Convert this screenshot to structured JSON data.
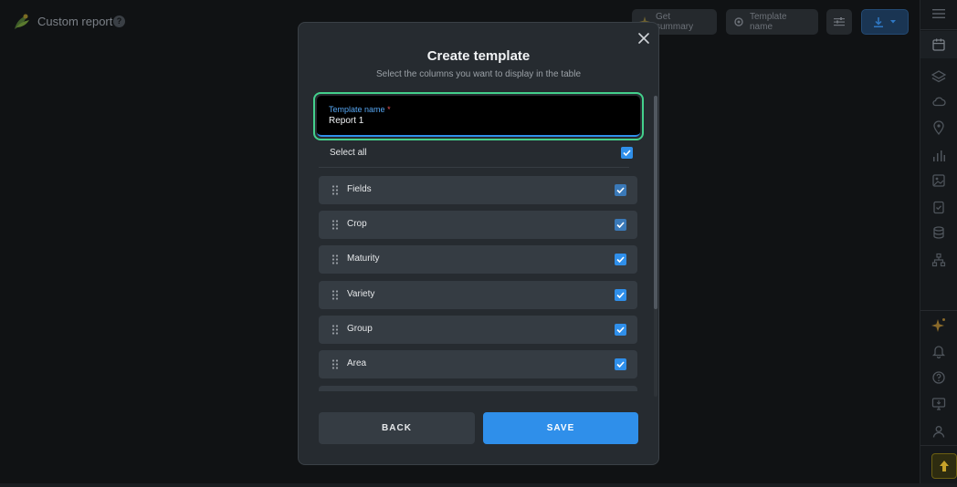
{
  "app": {
    "title": "Custom report",
    "help_glyph": "?"
  },
  "toolbar": {
    "summary_label": "Get summary",
    "template_label": "Template name"
  },
  "modal": {
    "title": "Create template",
    "subtitle": "Select the columns you want to display in the table",
    "name_field": {
      "label": "Template name",
      "required_mark": "*",
      "value": "Report 1"
    },
    "select_all": {
      "label": "Select all",
      "checked": true
    },
    "columns": [
      {
        "label": "Fields",
        "checked": true
      },
      {
        "label": "Crop",
        "checked": true
      },
      {
        "label": "Maturity",
        "checked": true
      },
      {
        "label": "Variety",
        "checked": true
      },
      {
        "label": "Group",
        "checked": true
      },
      {
        "label": "Area",
        "checked": true
      }
    ],
    "back_label": "BACK",
    "save_label": "SAVE"
  },
  "colors": {
    "accent": "#2f8fea",
    "focus_ring": "#43d08c",
    "modal_bg": "#262b30",
    "row_bg": "#353c43"
  }
}
